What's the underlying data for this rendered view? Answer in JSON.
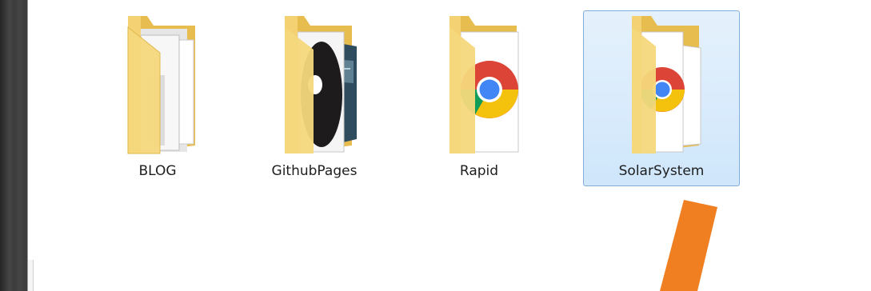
{
  "window": {
    "view": "large-icons"
  },
  "folders": [
    {
      "name": "BLOG",
      "preview": "documents",
      "selected": false
    },
    {
      "name": "GithubPages",
      "preview": "images",
      "selected": false
    },
    {
      "name": "Rapid",
      "preview": "chrome-icon",
      "selected": false
    },
    {
      "name": "SolarSystem",
      "preview": "chrome-icon",
      "selected": true
    }
  ],
  "colors": {
    "selection_fill": "#d8ebfc",
    "selection_border": "#84acd9",
    "folder_yellow": "#f5d577",
    "annotation_arrow": "#f07f22"
  }
}
